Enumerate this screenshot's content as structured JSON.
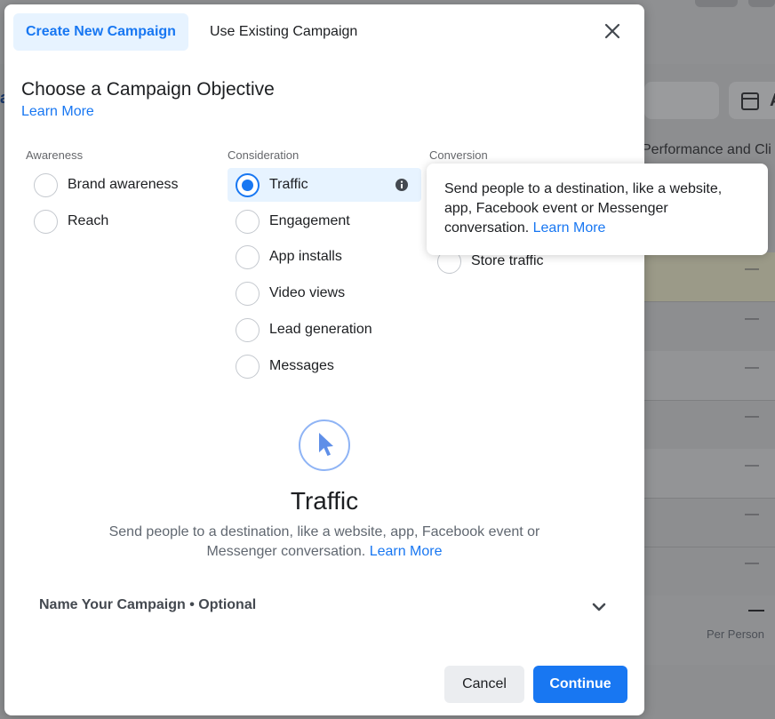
{
  "background": {
    "card_letter": "A",
    "performance_header": "Performance and Cli",
    "row_dash": "—",
    "bottom_dash": "—",
    "per_person": "Per Person",
    "left_letter": "a"
  },
  "modal": {
    "tabs": {
      "create": "Create New Campaign",
      "existing": "Use Existing Campaign"
    },
    "heading": "Choose a Campaign Objective",
    "learn_more": "Learn More",
    "columns": {
      "awareness": {
        "label": "Awareness",
        "options": [
          "Brand awareness",
          "Reach"
        ]
      },
      "consideration": {
        "label": "Consideration",
        "options": [
          "Traffic",
          "Engagement",
          "App installs",
          "Video views",
          "Lead generation",
          "Messages"
        ]
      },
      "conversion": {
        "label": "Conversion",
        "options": [
          "Store traffic"
        ]
      }
    },
    "selected_objective": "Traffic",
    "detail": {
      "title": "Traffic",
      "description": "Send people to a destination, like a website, app, Facebook event or Messenger conversation.",
      "learn_more": "Learn More"
    },
    "name_section": "Name Your Campaign • Optional",
    "buttons": {
      "cancel": "Cancel",
      "continue": "Continue"
    }
  },
  "tooltip": {
    "text": "Send people to a destination, like a website, app, Facebook event or Messenger conversation.",
    "learn_more": "Learn More"
  },
  "colors": {
    "accent": "#1877f2",
    "selected_bg": "#e7f3ff",
    "text": "#1c1e21",
    "muted": "#65676b"
  },
  "icons": [
    "close-icon",
    "info-icon",
    "cursor-icon",
    "chevron-down-icon"
  ]
}
